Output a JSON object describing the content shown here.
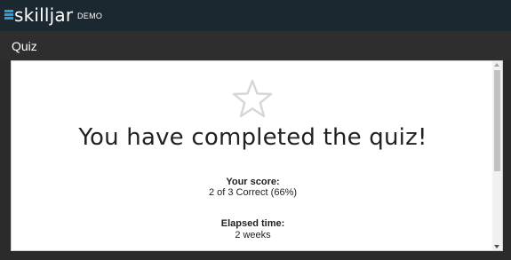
{
  "header": {
    "brand": "skilljar",
    "tag": "DEMO"
  },
  "section": {
    "title": "Quiz"
  },
  "result": {
    "star_icon": "star-outline-icon",
    "headline": "You have completed the quiz!",
    "score_label": "Your score:",
    "score_value": "2 of 3 Correct (66%)",
    "time_label": "Elapsed time:",
    "time_value": "2 weeks"
  },
  "colors": {
    "topbar": "#1b2830",
    "logo": "#2a9fd6",
    "background": "#2b2b2b",
    "star": "#d6d6d6"
  }
}
